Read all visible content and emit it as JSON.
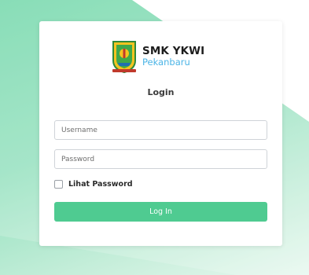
{
  "brand": {
    "name": "SMK YKWI",
    "city": "Pekanbaru",
    "logo_icon": "school-crest-icon"
  },
  "form": {
    "title": "Login",
    "username_placeholder": "Username",
    "password_placeholder": "Password",
    "show_password_label": "Lihat Password",
    "show_password_checked": false,
    "submit_label": "Log In"
  },
  "colors": {
    "accent": "#4fcb91",
    "background_green": "#6fd6a8",
    "brand_city": "#4bb4e6"
  }
}
